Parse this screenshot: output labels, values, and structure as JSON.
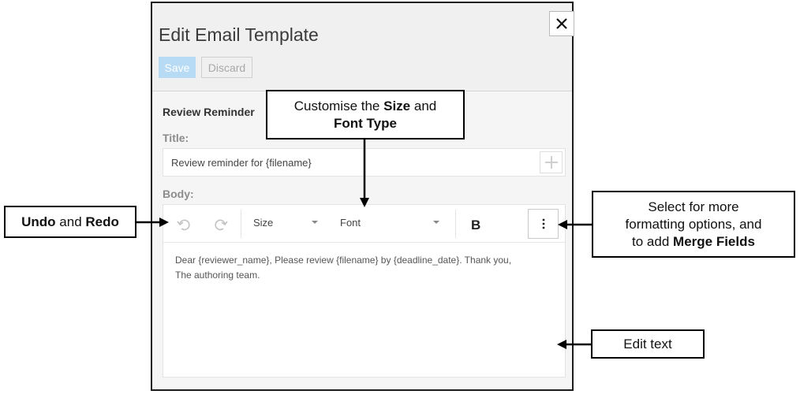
{
  "dialog": {
    "title": "Edit Email Template",
    "close_icon": "close-icon",
    "save_label": "Save",
    "discard_label": "Discard",
    "section_title": "Review Reminder",
    "title_label": "Title:",
    "title_value": "Review reminder for {filename}",
    "add_icon": "plus-icon",
    "body_label": "Body:",
    "toolbar": {
      "undo_icon": "undo-icon",
      "redo_icon": "redo-icon",
      "size_label": "Size",
      "font_label": "Font",
      "bold_label": "B",
      "more_icon": "more-vertical-icon"
    },
    "body_lines": [
      "Dear {reviewer_name}, Please review {filename} by {deadline_date}. Thank you,",
      "The authoring team."
    ]
  },
  "annotations": {
    "size_font": {
      "pre": "Customise the ",
      "bold1": "Size",
      "mid": " and",
      "bold2": "Font Type"
    },
    "undo_redo": {
      "bold1": "Undo",
      "mid": " and ",
      "bold2": "Redo"
    },
    "more_options": {
      "line1": "Select for more",
      "line2": "formatting options, and",
      "line3_pre": "to add ",
      "bold": "Merge Fields"
    },
    "edit_text": {
      "text": "Edit text"
    }
  },
  "colors": {
    "header_bg": "#f0f0f0",
    "body_bg": "#f5f5f5",
    "save_disabled": "#b7dbf4",
    "annotation_border": "#000000"
  }
}
